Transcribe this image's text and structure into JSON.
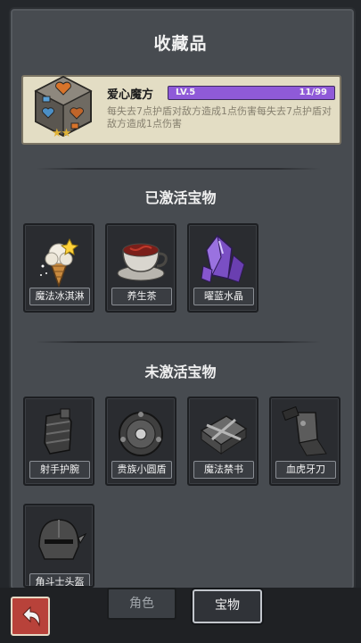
{
  "header": {
    "title": "收藏品"
  },
  "featured": {
    "name": "爱心魔方",
    "level": "LV.5",
    "progress": "11/99",
    "progress_fraction": 0.11,
    "description": "每失去7点护盾对敌方造成1点伤害每失去7点护盾对敌方造成1点伤害",
    "stars": "★★"
  },
  "activated": {
    "title": "已激活宝物",
    "items": [
      {
        "label": "魔法冰淇淋",
        "icon": "ice-cream-icon"
      },
      {
        "label": "养生茶",
        "icon": "tea-cup-icon"
      },
      {
        "label": "曜蓝水晶",
        "icon": "crystal-icon"
      }
    ]
  },
  "inactive": {
    "title": "未激活宝物",
    "items": [
      {
        "label": "射手护腕",
        "icon": "bracer-icon"
      },
      {
        "label": "贵族小圆盾",
        "icon": "round-shield-icon"
      },
      {
        "label": "魔法禁书",
        "icon": "forbidden-book-icon"
      },
      {
        "label": "血虎牙刀",
        "icon": "cleaver-icon"
      },
      {
        "label": "角斗士头盔",
        "icon": "helmet-icon"
      }
    ]
  },
  "nav": {
    "back_icon": "back-arrow-icon",
    "tab_role": "角色",
    "tab_treasure": "宝物"
  },
  "colors": {
    "level_bar": "#8f5ad8",
    "back_button": "#b8423a",
    "card_bg": "#e3ddc4"
  }
}
